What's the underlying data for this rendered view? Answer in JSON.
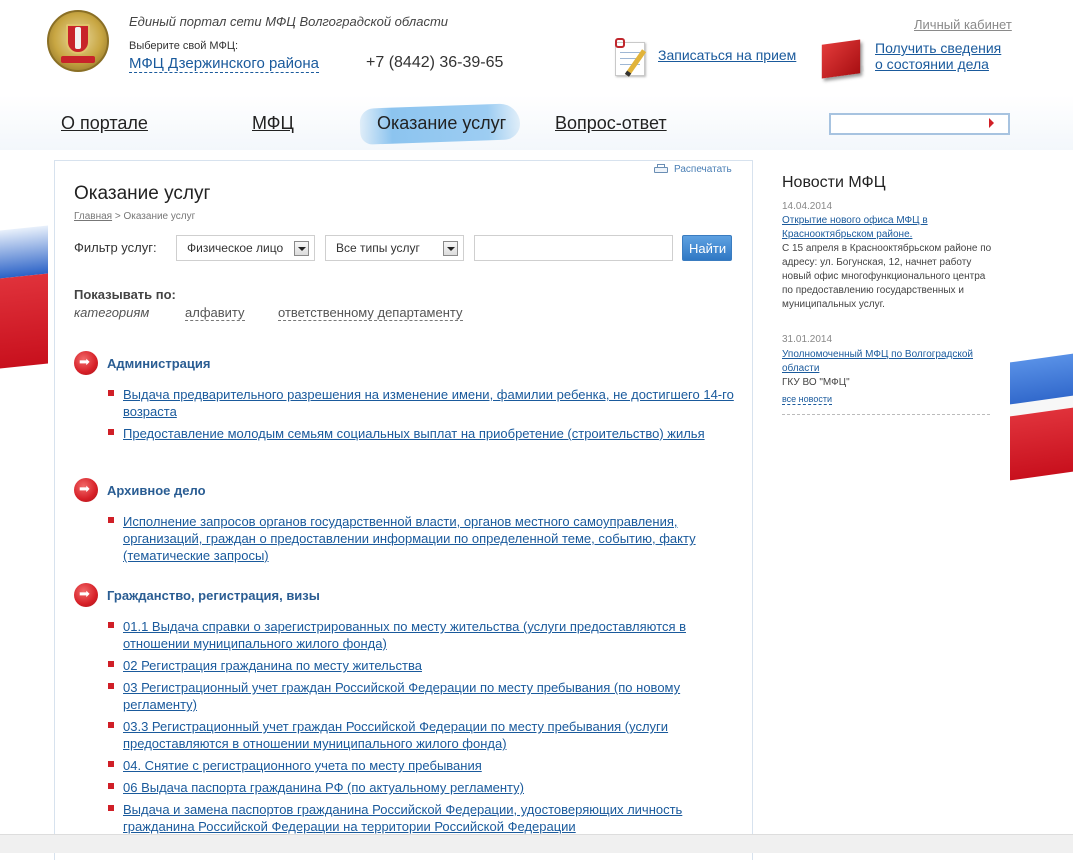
{
  "header": {
    "portal_title": "Единый портал сети МФЦ Волгоградской области",
    "choose_label": "Выберите свой МФЦ:",
    "mfc_name": "МФЦ Дзержинского района",
    "phone": "+7 (8442) 36-39-65",
    "cabinet": "Личный кабинет",
    "appointment": "Записаться на прием",
    "status_line1": "Получить сведения",
    "status_line2": "о состоянии дела"
  },
  "nav": {
    "items": [
      "О портале",
      "МФЦ",
      "Оказание услуг",
      "Вопрос-ответ"
    ],
    "search_placeholder": ""
  },
  "main": {
    "print": "Распечатать",
    "title": "Оказание услуг",
    "breadcrumb_home": "Главная",
    "breadcrumb_sep": " > ",
    "breadcrumb_current": "Оказание услуг",
    "filter_label": "Фильтр услуг:",
    "filter_person": "Физическое лицо",
    "filter_type": "Все типы услуг",
    "filter_text": "",
    "find_button": "Найти",
    "show_by_label": "Показывать по:",
    "show_by_options": [
      "категориям",
      "алфавиту",
      "ответственному департаменту"
    ],
    "categories": [
      {
        "title": "Администрация",
        "services": [
          "Выдача предварительного разрешения на изменение имени, фамилии ребенка, не достигшего 14-го возраста",
          "Предоставление молодым семьям социальных выплат на приобретение (строительство) жилья"
        ]
      },
      {
        "title": "Архивное дело",
        "services": [
          "Исполнение запросов органов государственной власти, органов местного самоуправления, организаций, граждан о предоставлении информации по определенной теме, событию, факту (тематические запросы)"
        ]
      },
      {
        "title": "Гражданство, регистрация, визы",
        "services": [
          "01.1 Выдача справки о зарегистрированных по месту жительства (услуги предоставляются в отношении муниципального жилого фонда)",
          "02 Регистрация гражданина по месту жительства",
          "03 Регистрационный учет граждан Российской Федерации по месту пребывания (по новому регламенту)",
          "03.3 Регистрационный учет граждан Российской Федерации по месту пребывания (услуги предоставляются в отношении муниципального жилого фонда)",
          "04. Снятие с регистрационного учета по месту пребывания",
          "06 Выдача паспорта гражданина РФ (по актуальному регламенту)",
          "Выдача и замена паспортов гражданина Российской Федерации, удостоверяющих личность гражданина Российской Федерации на территории Российской Федерации"
        ]
      }
    ]
  },
  "news": {
    "title": "Новости МФЦ",
    "items": [
      {
        "date": "14.04.2014",
        "link": "Открытие нового офиса МФЦ в Краснооктябрьском районе.",
        "text": "С 15 апреля в Краснооктябрьском районе  по адресу: ул. Богунская, 12, начнет работу новый офис многофункционального центра по предоставлению государственных и муниципальных услуг."
      },
      {
        "date": "31.01.2014",
        "link": "Уполномоченный МФЦ по Волгоградской области",
        "text": "ГКУ ВО \"МФЦ\""
      }
    ],
    "all_news": "все новости"
  },
  "colors": {
    "link": "#1a5a9c",
    "accent_red": "#d01f27",
    "nav_highlight": "#8cc4ef"
  }
}
